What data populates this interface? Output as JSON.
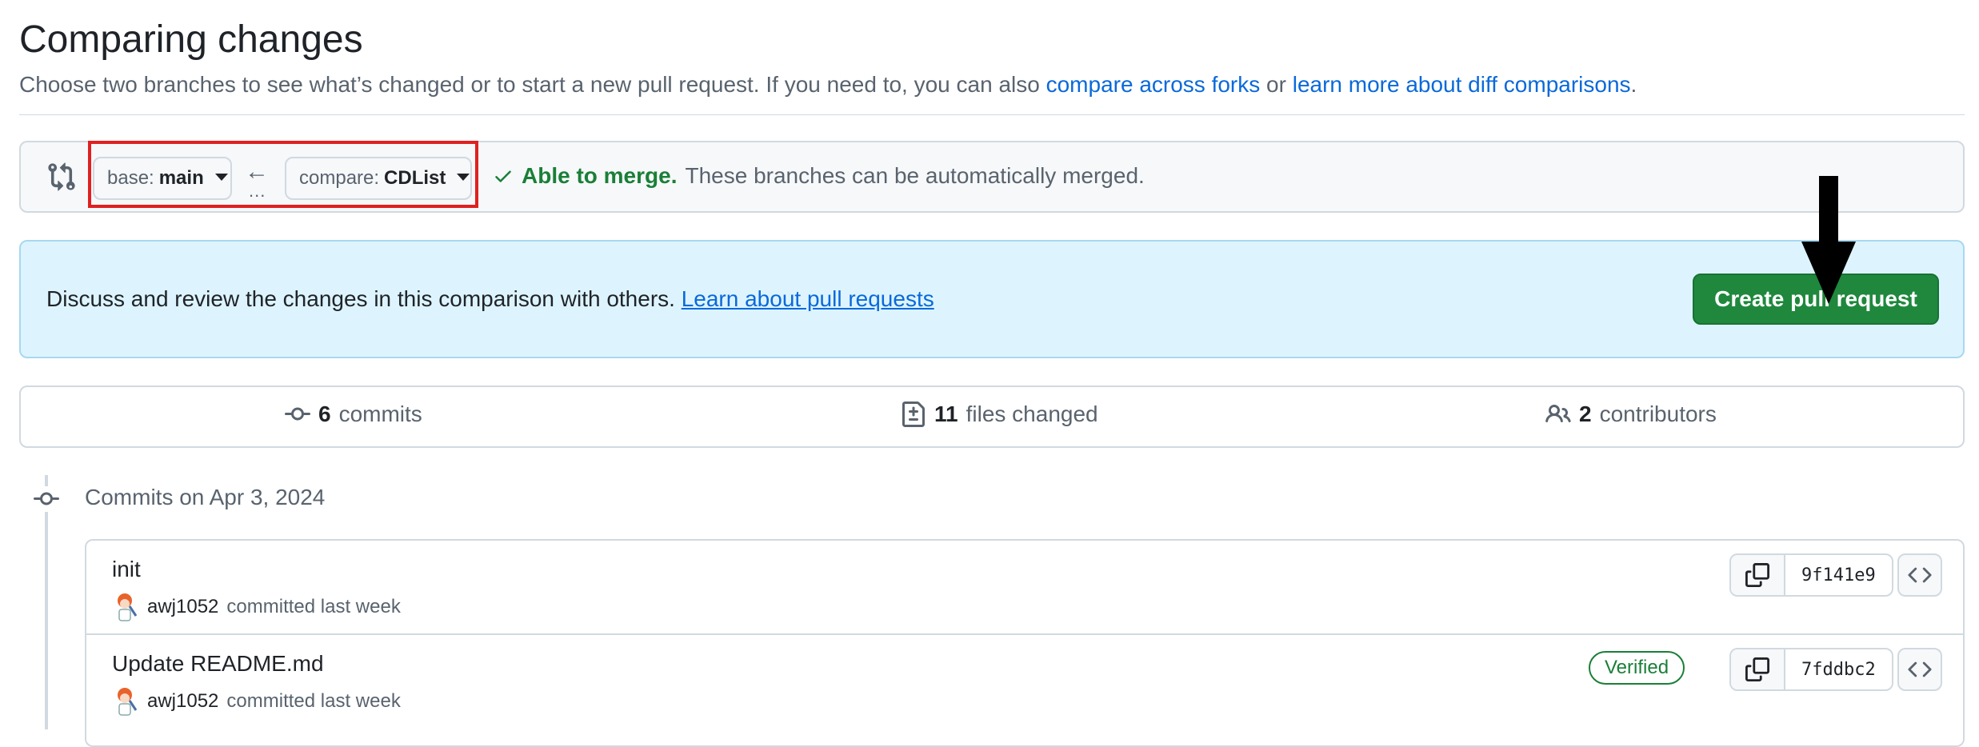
{
  "header": {
    "title": "Comparing changes",
    "subtitle_prefix": "Choose two branches to see what’s changed or to start a new pull request. If you need to, you can also ",
    "compare_forks_link": "compare across forks",
    "subtitle_or": " or ",
    "learn_diff_link": "learn more about diff comparisons",
    "subtitle_suffix": "."
  },
  "range": {
    "base_prefix": "base:",
    "base_branch": "main",
    "compare_prefix": "compare:",
    "compare_branch": "CDList",
    "ellipsis": "...",
    "merge_ok": "Able to merge.",
    "merge_desc": "These branches can be automatically merged."
  },
  "discuss": {
    "text": "Discuss and review the changes in this comparison with others. ",
    "link": "Learn about pull requests",
    "create_button": "Create pull request"
  },
  "stats": {
    "commits_count": "6",
    "commits_label": "commits",
    "files_count": "11",
    "files_label": "files changed",
    "contributors_count": "2",
    "contributors_label": "contributors"
  },
  "timeline": {
    "date_heading": "Commits on Apr 3, 2024",
    "commits": [
      {
        "title": "init",
        "author": "awj1052",
        "action": "committed last week",
        "sha": "9f141e9"
      },
      {
        "title": "Update README.md",
        "author": "awj1052",
        "action": "committed last week",
        "sha": "7fddbc2",
        "badge": "Verified"
      }
    ]
  },
  "colors": {
    "accent_link": "#0969da",
    "success_green": "#1f883d",
    "highlight_red": "#e02020",
    "info_bg": "#ddf4ff"
  },
  "icons": [
    "compare-icon",
    "arrow-left-icon",
    "check-icon",
    "commit-icon",
    "file-diff-icon",
    "people-icon",
    "copy-icon",
    "code-icon",
    "avatar"
  ]
}
